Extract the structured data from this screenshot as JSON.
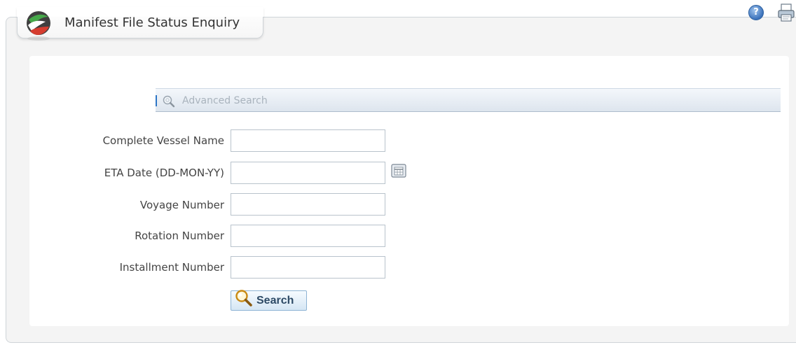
{
  "header": {
    "title": "Manifest File Status Enquiry",
    "help_icon": "help-icon",
    "print_icon": "print-icon"
  },
  "advanced_search": {
    "label": "Advanced Search",
    "icon": "magnifier-icon"
  },
  "form": {
    "fields": [
      {
        "label": "Complete Vessel Name",
        "value": ""
      },
      {
        "label": "ETA Date (DD-MON-YY)",
        "value": ""
      },
      {
        "label": "Voyage Number",
        "value": ""
      },
      {
        "label": "Rotation Number",
        "value": ""
      },
      {
        "label": "Installment Number",
        "value": ""
      }
    ],
    "search_label": "Search"
  },
  "colors": {
    "accent_blue": "#2d76c6",
    "panel_bg": "#f4f4f4",
    "bar_gradient_end": "#dde5ee"
  }
}
